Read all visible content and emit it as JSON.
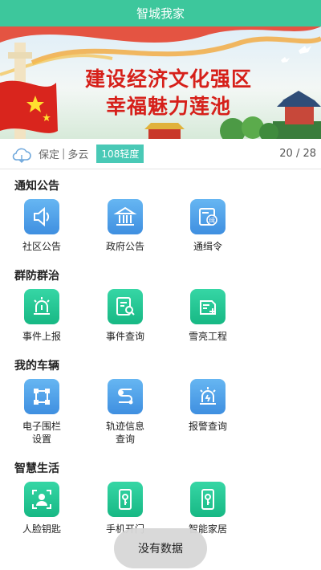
{
  "header": {
    "title": "智城我家"
  },
  "banner": {
    "line1": "建设经济文化强区",
    "line2": "幸福魅力莲池"
  },
  "weather": {
    "icon": "cloud-icon",
    "city": "保定",
    "separator": "|",
    "condition": "多云",
    "aqi": "108轻度",
    "pager": "20 / 28"
  },
  "sections": [
    {
      "title": "通知公告",
      "items": [
        {
          "label": "社区公告",
          "icon": "speaker-icon"
        },
        {
          "label": "政府公告",
          "icon": "government-building-icon"
        },
        {
          "label": "通缉令",
          "icon": "wanted-notice-icon",
          "badge": "缉"
        }
      ]
    },
    {
      "title": "群防群治",
      "items": [
        {
          "label": "事件上报",
          "icon": "alarm-light-icon"
        },
        {
          "label": "事件查询",
          "icon": "document-search-icon"
        },
        {
          "label": "雪亮工程",
          "icon": "add-document-icon"
        }
      ]
    },
    {
      "title": "我的车辆",
      "items": [
        {
          "label": "电子围栏\n设置",
          "label_lines": [
            "电子围栏",
            "设置"
          ],
          "icon": "fence-icon"
        },
        {
          "label": "轨迹信息\n查询",
          "label_lines": [
            "轨迹信息",
            "查询"
          ],
          "icon": "route-icon"
        },
        {
          "label": "报警查询",
          "icon": "alarm-light-icon"
        }
      ]
    },
    {
      "title": "智慧生活",
      "items": [
        {
          "label": "人脸钥匙",
          "icon": "face-id-icon"
        },
        {
          "label": "手机开门",
          "icon": "phone-key-icon"
        },
        {
          "label": "智能家居",
          "icon": "phone-key-icon"
        }
      ]
    }
  ],
  "toast": {
    "text": "没有数据"
  },
  "colors": {
    "header": "#3dc79c",
    "blue_icon": "#4a9be6",
    "green_icon": "#22c08e",
    "aqi": "#49c9b6",
    "slogan": "#d6201a"
  }
}
